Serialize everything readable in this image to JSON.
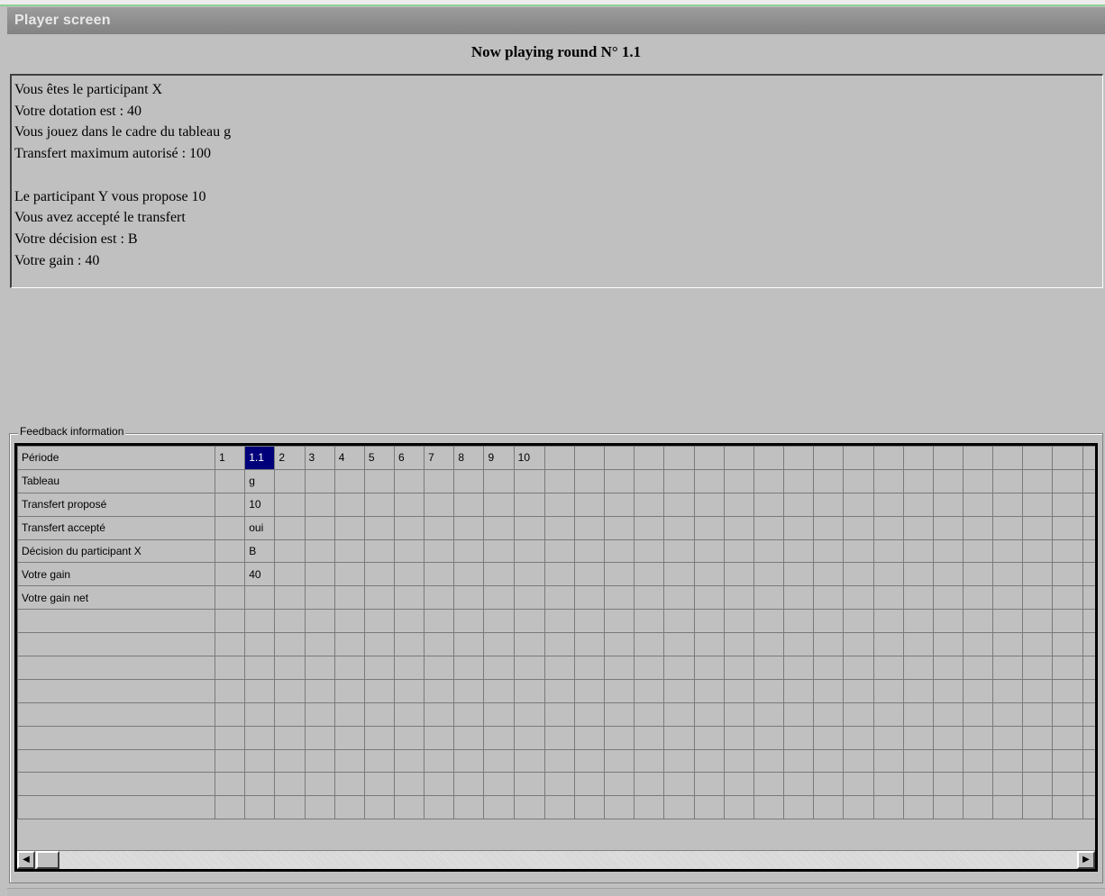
{
  "window": {
    "title": "Player screen"
  },
  "round_title": "Now playing round N° 1.1",
  "messages": {
    "lines_a": [
      "Vous êtes le participant X",
      "Votre dotation est : 40",
      "Vous jouez dans le cadre du tableau g",
      "Transfert maximum autorisé : 100"
    ],
    "lines_b": [
      "Le participant Y vous propose 10",
      "Vous avez accepté le transfert",
      "Votre décision est : B",
      "Votre gain : 40"
    ]
  },
  "feedback": {
    "legend": "Feedback information",
    "row_labels": [
      "Période",
      "Tableau",
      "Transfert proposé",
      "Transfert accepté",
      "Décision du participant X",
      "Votre gain",
      "Votre gain net"
    ],
    "periods": [
      "1",
      "1.1",
      "2",
      "3",
      "4",
      "5",
      "6",
      "7",
      "8",
      "9",
      "10"
    ],
    "selected_period": "1.1",
    "column_values": {
      "1.1": [
        "g",
        "10",
        "oui",
        "B",
        "40",
        ""
      ]
    },
    "extra_empty_columns": 19,
    "empty_rows": 9
  },
  "scrollbar": {
    "left_arrow_icon": "arrow-left-icon",
    "right_arrow_icon": "arrow-right-icon"
  }
}
